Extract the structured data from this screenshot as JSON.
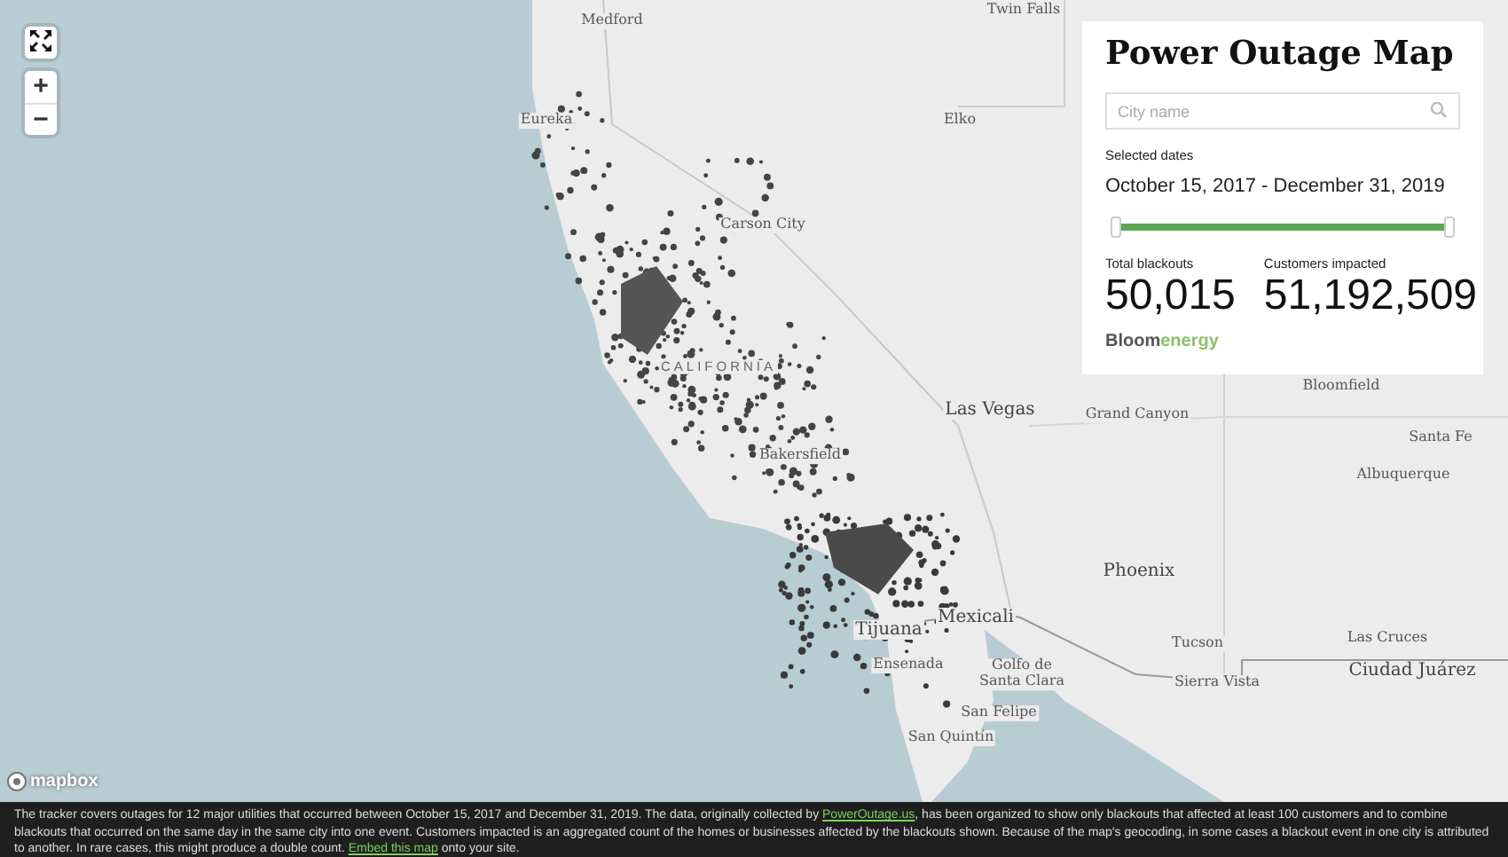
{
  "map_controls": {
    "zoom_in": "+",
    "zoom_out": "−"
  },
  "map_labels": [
    {
      "text": "Medford",
      "kind": "city"
    },
    {
      "text": "Twin Falls",
      "kind": "city"
    },
    {
      "text": "Eureka",
      "kind": "city"
    },
    {
      "text": "Elko",
      "kind": "city"
    },
    {
      "text": "Carson City",
      "kind": "city"
    },
    {
      "text": "CALIFORNIA",
      "kind": "state"
    },
    {
      "text": "Bakersfield",
      "kind": "city"
    },
    {
      "text": "Las Vegas",
      "kind": "major"
    },
    {
      "text": "Grand Canyon",
      "kind": "city"
    },
    {
      "text": "Bloomfield",
      "kind": "city"
    },
    {
      "text": "Santa Fe",
      "kind": "city"
    },
    {
      "text": "Albuquerque",
      "kind": "city"
    },
    {
      "text": "Phoenix",
      "kind": "major"
    },
    {
      "text": "Tucson",
      "kind": "city"
    },
    {
      "text": "Sierra Vista",
      "kind": "city"
    },
    {
      "text": "Las Cruces",
      "kind": "city"
    },
    {
      "text": "Ciudad Juárez",
      "kind": "major"
    },
    {
      "text": "Tijuana",
      "kind": "major"
    },
    {
      "text": "Mexicali",
      "kind": "major"
    },
    {
      "text": "Ensenada",
      "kind": "city"
    },
    {
      "text": "Golfo de Santa Clara",
      "kind": "city"
    },
    {
      "text": "San Felipe",
      "kind": "city"
    },
    {
      "text": "San Quintín",
      "kind": "city"
    }
  ],
  "attribution": "mapbox",
  "panel": {
    "title": "Power Outage Map",
    "search": {
      "placeholder": "City name"
    },
    "dates_label": "Selected dates",
    "dates": "October 15, 2017 - December 31, 2019",
    "date_slider": {
      "level": 1
    },
    "stats": [
      {
        "label": "Total blackouts",
        "value": "50,015"
      },
      {
        "label": "Customers impacted",
        "value": "51,192,509"
      }
    ],
    "logo": [
      "Bloom",
      "energy"
    ]
  },
  "footer": [
    {
      "kind": "text",
      "text": "The tracker covers outages for 12 major utilities that occurred between October 15, 2017 and December 31, 2019. The data, originally collected by "
    },
    {
      "kind": "link",
      "text": "PowerOutage.us"
    },
    {
      "kind": "text",
      "text": ", has been organized to show only blackouts that affected at least 100 customers and to combine blackouts that occurred on the same day in the same city into one event. Customers impacted is an aggregated count of the homes or businesses affected by the blackouts shown. Because of the map's geocoding, in some cases a blackout event in one city is attributed to another. In rare cases, this might produce a double count. "
    },
    {
      "kind": "link",
      "text": "Embed this map"
    },
    {
      "kind": "text",
      "text": " onto your site."
    }
  ]
}
